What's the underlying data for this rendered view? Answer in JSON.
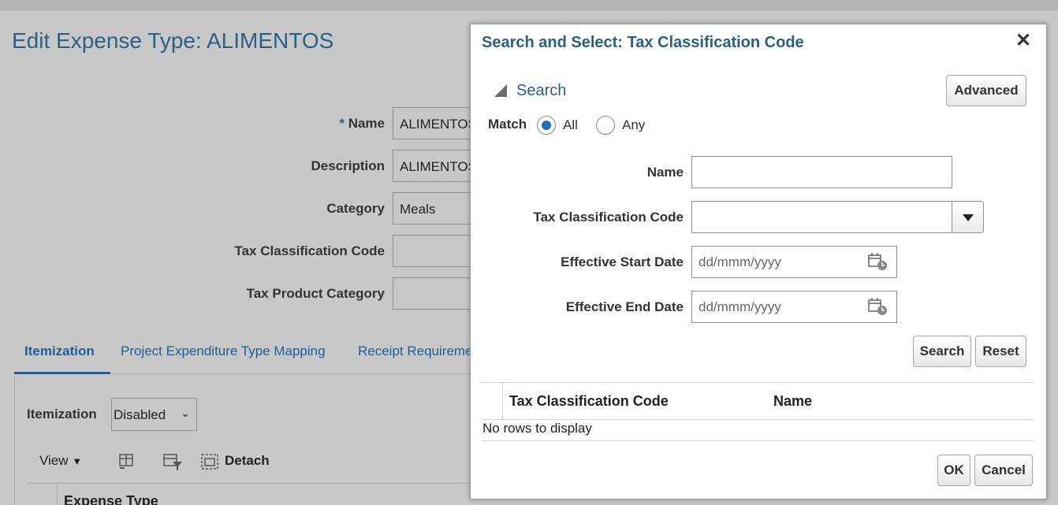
{
  "background": {
    "page_title": "Edit Expense Type: ALIMENTOS",
    "form": {
      "required_marker": "*",
      "name_label": "Name",
      "name_value": "ALIMENTOS",
      "description_label": "Description",
      "description_value": "ALIMENTOS",
      "category_label": "Category",
      "category_value": "Meals",
      "tax_class_label": "Tax Classification Code",
      "tax_class_value": "",
      "tax_product_label": "Tax Product Category",
      "tax_product_value": ""
    },
    "tabs": [
      {
        "label": "Itemization"
      },
      {
        "label": "Project Expenditure Type Mapping"
      },
      {
        "label": "Receipt Requirements"
      }
    ],
    "itemization_label": "Itemization",
    "itemization_value": "Disabled",
    "toolbar": {
      "view_label": "View",
      "detach_label": "Detach"
    },
    "table_header": "Expense Type"
  },
  "dialog": {
    "title": "Search and Select: Tax Classification Code",
    "search_header": "Search",
    "advanced_button": "Advanced",
    "match_label": "Match",
    "match_all": "All",
    "match_any": "Any",
    "fields": {
      "name_label": "Name",
      "name_value": "",
      "tax_class_label": "Tax Classification Code",
      "tax_class_value": "",
      "start_label": "Effective Start Date",
      "start_placeholder": "dd/mmm/yyyy",
      "end_label": "Effective End Date",
      "end_placeholder": "dd/mmm/yyyy"
    },
    "search_button": "Search",
    "reset_button": "Reset",
    "results": {
      "columns": [
        "Tax Classification Code",
        "Name"
      ],
      "empty_text": "No rows to display"
    },
    "ok_button": "OK",
    "cancel_button": "Cancel"
  }
}
